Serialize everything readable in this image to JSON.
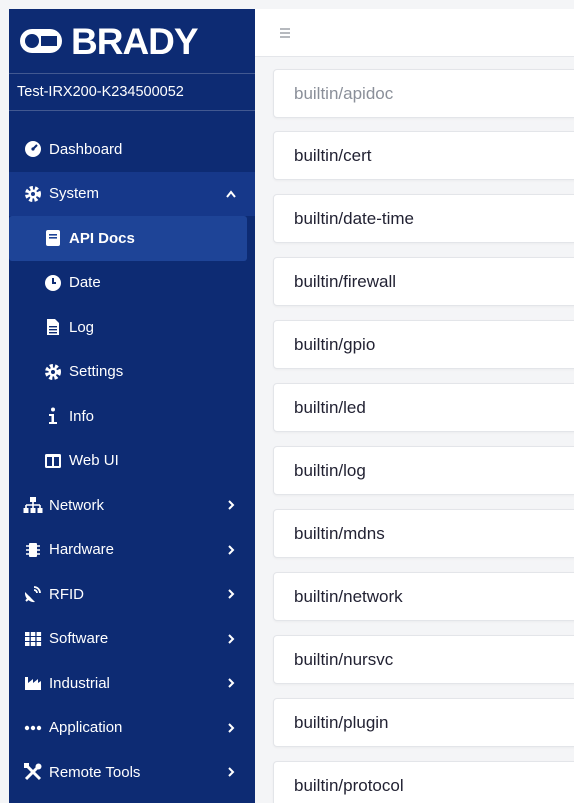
{
  "brand": {
    "name": "BRADY"
  },
  "device": {
    "name": "Test-IRX200-K234500052"
  },
  "nav": {
    "dashboard": {
      "label": "Dashboard",
      "icon": "tachometer-icon"
    },
    "system": {
      "label": "System",
      "icon": "cog-icon"
    },
    "api_docs": {
      "label": "API Docs",
      "icon": "book-icon"
    },
    "date": {
      "label": "Date",
      "icon": "clock-icon"
    },
    "log": {
      "label": "Log",
      "icon": "file-icon"
    },
    "settings": {
      "label": "Settings",
      "icon": "cog-icon"
    },
    "info": {
      "label": "Info",
      "icon": "info-icon"
    },
    "web_ui": {
      "label": "Web UI",
      "icon": "columns-icon"
    },
    "network": {
      "label": "Network",
      "icon": "sitemap-icon"
    },
    "hardware": {
      "label": "Hardware",
      "icon": "chip-icon"
    },
    "rfid": {
      "label": "RFID",
      "icon": "satellite-dish-icon"
    },
    "software": {
      "label": "Software",
      "icon": "grid-icon"
    },
    "industrial": {
      "label": "Industrial",
      "icon": "industry-icon"
    },
    "application": {
      "label": "Application",
      "icon": "ellipsis-icon"
    },
    "remote_tools": {
      "label": "Remote Tools",
      "icon": "tools-icon"
    }
  },
  "api_list": [
    "builtin/apidoc",
    "builtin/cert",
    "builtin/date-time",
    "builtin/firewall",
    "builtin/gpio",
    "builtin/led",
    "builtin/log",
    "builtin/mdns",
    "builtin/network",
    "builtin/nursvc",
    "builtin/plugin",
    "builtin/protocol"
  ],
  "colors": {
    "sidebar": "#0d2b73",
    "active_item": "#1e4497"
  }
}
